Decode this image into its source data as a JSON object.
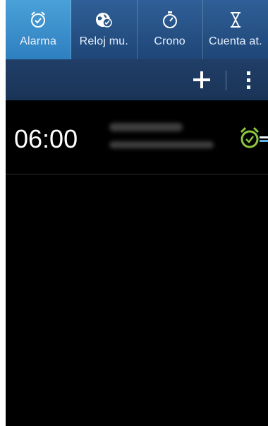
{
  "tabs": [
    {
      "label": "Alarma",
      "icon": "alarm-clock-icon",
      "active": true
    },
    {
      "label": "Reloj mu.",
      "icon": "world-clock-icon",
      "active": false
    },
    {
      "label": "Crono",
      "icon": "stopwatch-icon",
      "active": false
    },
    {
      "label": "Cuenta at.",
      "icon": "hourglass-icon",
      "active": false
    }
  ],
  "actionbar": {
    "add_icon": "plus-icon",
    "menu_icon": "more-vertical-icon"
  },
  "alarm": {
    "time": "06:00",
    "toggle_icon": "alarm-on-icon",
    "toggle_color": "#8dc63f"
  },
  "colors": {
    "tab_active": "#3a92cf",
    "tab_bar": "#2a5688",
    "action_bar": "#1d3a60",
    "background": "#000000"
  }
}
